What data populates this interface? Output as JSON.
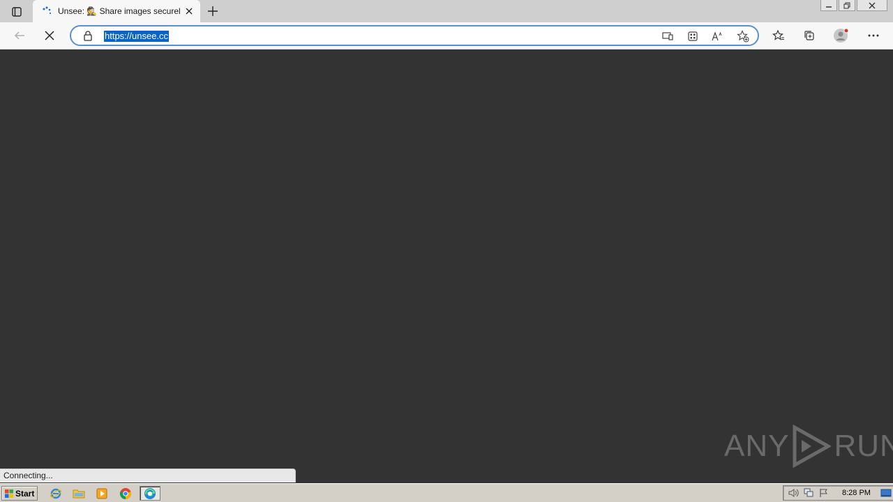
{
  "browser": {
    "tab": {
      "title": "Unsee: 🕵 Share images securely"
    },
    "address": {
      "url": "https://unsee.cc"
    },
    "status_text": "Connecting..."
  },
  "watermark": {
    "left": "ANY",
    "right": "RUN"
  },
  "taskbar": {
    "start_label": "Start",
    "apps": [
      "internet-explorer",
      "file-explorer",
      "media-player",
      "chrome",
      "edge"
    ],
    "clock": "8:28 PM"
  },
  "colors": {
    "page_bg": "#333333",
    "tabstrip_bg": "#cfcfcf",
    "toolbar_bg": "#f7f7f7",
    "url_highlight": "#0a64c8",
    "address_border": "#5a8fd6"
  }
}
